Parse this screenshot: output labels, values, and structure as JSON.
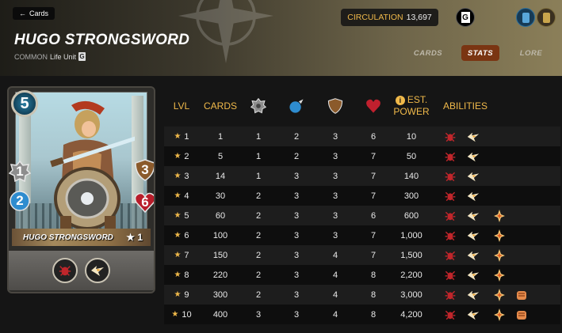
{
  "header": {
    "back_label": "Cards",
    "title": "HUGO STRONGSWORD",
    "rarity": "COMMON",
    "type": "Life Unit",
    "circulation_label": "CIRCULATION",
    "circulation_value": "13,697",
    "edition_letter": "G",
    "tabs": [
      {
        "label": "CARDS",
        "active": false
      },
      {
        "label": "STATS",
        "active": true
      },
      {
        "label": "LORE",
        "active": false
      }
    ]
  },
  "card": {
    "mana": "5",
    "melee": "1",
    "speed": "2",
    "armor": "3",
    "health": "6",
    "name": "HUGO STRONGSWORD",
    "level": "★ 1",
    "abilities": [
      "affliction-icon",
      "slow-icon"
    ]
  },
  "table": {
    "headers": {
      "lvl": "LVL",
      "cards": "CARDS",
      "est_power_line1": "EST.",
      "est_power_line2": "POWER",
      "abilities": "ABILITIES"
    },
    "header_icons": [
      "melee-attack-icon",
      "speed-icon",
      "armor-icon",
      "health-icon"
    ],
    "rows": [
      {
        "lvl": "1",
        "cards": "1",
        "melee": "1",
        "speed": "2",
        "armor": "3",
        "health": "6",
        "power": "10",
        "abilities": [
          "affliction",
          "slow"
        ]
      },
      {
        "lvl": "2",
        "cards": "5",
        "melee": "1",
        "speed": "2",
        "armor": "3",
        "health": "7",
        "power": "50",
        "abilities": [
          "affliction",
          "slow"
        ]
      },
      {
        "lvl": "3",
        "cards": "14",
        "melee": "1",
        "speed": "3",
        "armor": "3",
        "health": "7",
        "power": "140",
        "abilities": [
          "affliction",
          "slow"
        ]
      },
      {
        "lvl": "4",
        "cards": "30",
        "melee": "2",
        "speed": "3",
        "armor": "3",
        "health": "7",
        "power": "300",
        "abilities": [
          "affliction",
          "slow"
        ]
      },
      {
        "lvl": "5",
        "cards": "60",
        "melee": "2",
        "speed": "3",
        "armor": "3",
        "health": "6",
        "power": "600",
        "abilities": [
          "affliction",
          "slow",
          "spark"
        ]
      },
      {
        "lvl": "6",
        "cards": "100",
        "melee": "2",
        "speed": "3",
        "armor": "3",
        "health": "7",
        "power": "1,000",
        "abilities": [
          "affliction",
          "slow",
          "spark"
        ]
      },
      {
        "lvl": "7",
        "cards": "150",
        "melee": "2",
        "speed": "3",
        "armor": "4",
        "health": "7",
        "power": "1,500",
        "abilities": [
          "affliction",
          "slow",
          "spark"
        ]
      },
      {
        "lvl": "8",
        "cards": "220",
        "melee": "2",
        "speed": "3",
        "armor": "4",
        "health": "8",
        "power": "2,200",
        "abilities": [
          "affliction",
          "slow",
          "spark"
        ]
      },
      {
        "lvl": "9",
        "cards": "300",
        "melee": "2",
        "speed": "3",
        "armor": "4",
        "health": "8",
        "power": "3,000",
        "abilities": [
          "affliction",
          "slow",
          "spark",
          "fist"
        ]
      },
      {
        "lvl": "10",
        "cards": "400",
        "melee": "3",
        "speed": "3",
        "armor": "4",
        "health": "8",
        "power": "4,200",
        "abilities": [
          "affliction",
          "slow",
          "spark",
          "fist"
        ]
      }
    ]
  }
}
